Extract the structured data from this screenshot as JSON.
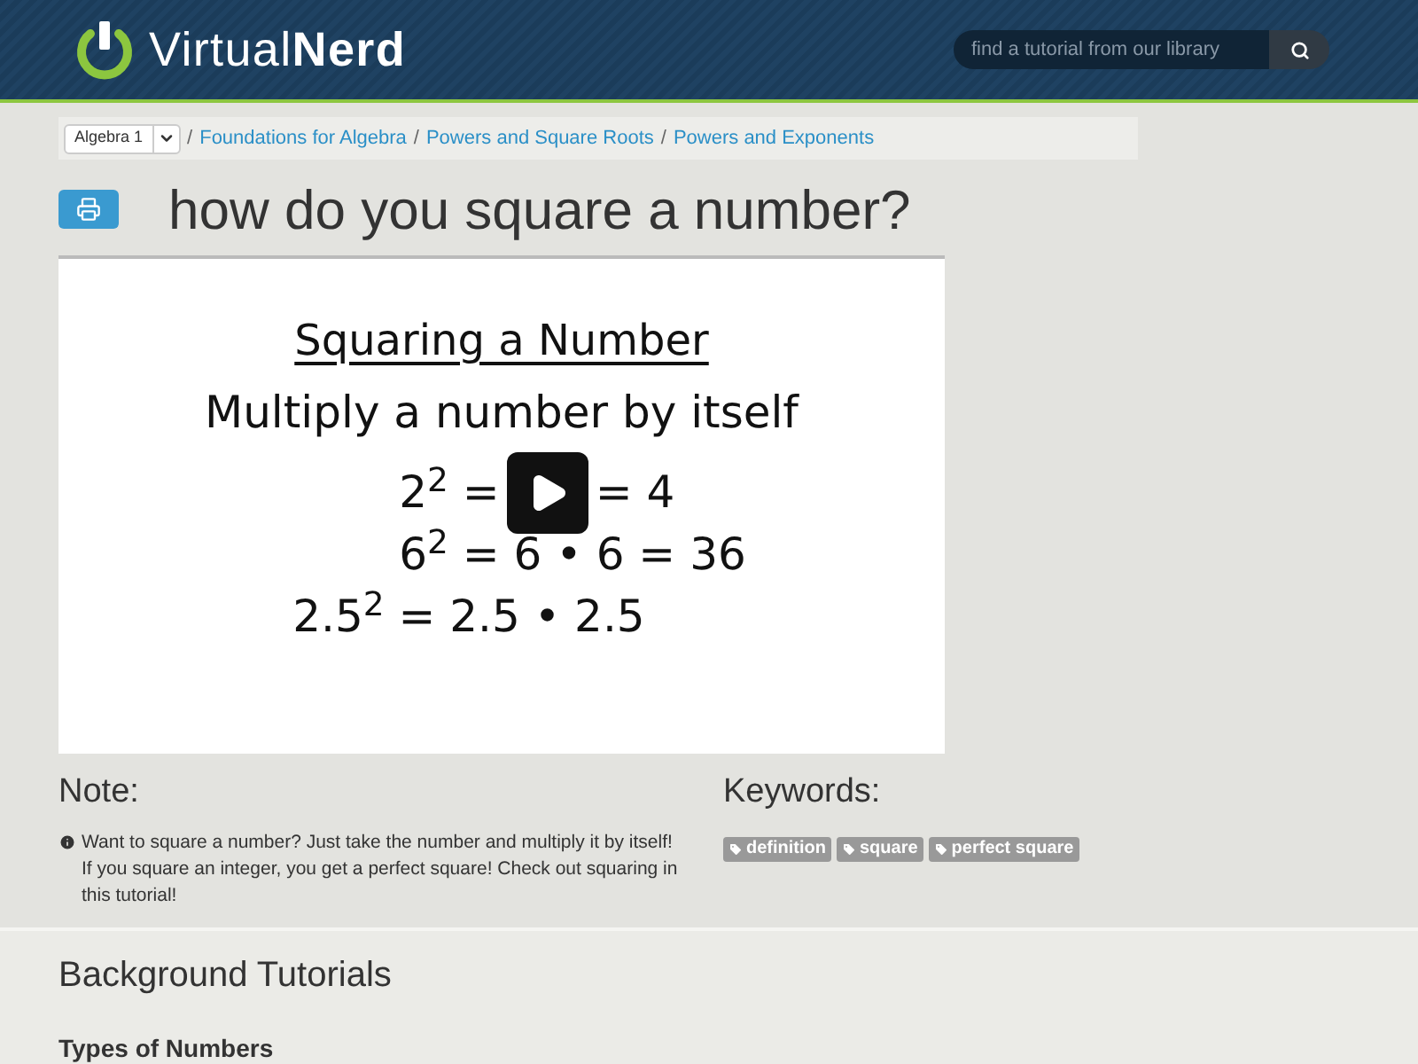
{
  "header": {
    "logo": {
      "light": "Virtual",
      "bold": "Nerd"
    },
    "search": {
      "placeholder": "find a tutorial from our library"
    }
  },
  "breadcrumb": {
    "course": "Algebra 1",
    "items": [
      {
        "separator": "/",
        "label": "Foundations for Algebra"
      },
      {
        "separator": "/",
        "label": "Powers and Square Roots"
      },
      {
        "separator": "/",
        "label": "Powers and Exponents"
      }
    ]
  },
  "title": "how do you square a number?",
  "video": {
    "heading": "Squaring a Number",
    "subheading": "Multiply a number by itself",
    "lines": [
      {
        "kind": "split",
        "left": "2$^{2}$ =",
        "right": "= 4"
      },
      {
        "kind": "plain",
        "left": "6$^{2}$ = 6 • 6 = 36"
      },
      {
        "kind": "plain",
        "left": "2.5$^{2}$ = 2.5 • 2.5"
      }
    ]
  },
  "note": {
    "heading": "Note:",
    "text": "Want to square a number? Just take the number and multiply it by itself! If you square an integer, you get a perfect square! Check out squaring in this tutorial!"
  },
  "keywords": {
    "heading": "Keywords:",
    "tags": [
      "definition",
      "square",
      "perfect square"
    ]
  },
  "background": {
    "heading": "Background Tutorials",
    "items": [
      "Types of Numbers"
    ]
  }
}
